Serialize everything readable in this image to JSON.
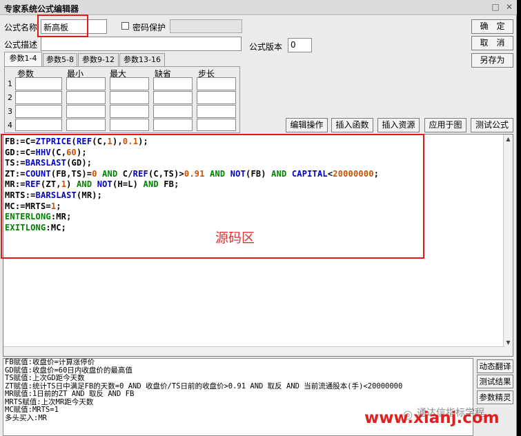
{
  "window": {
    "title": "专家系统公式编辑器",
    "min_icon": "□",
    "close_icon": "✕"
  },
  "form": {
    "name_label": "公式名称",
    "name_value": "新高板",
    "password_label": "密码保护",
    "desc_label": "公式描述",
    "desc_value": "",
    "version_label": "公式版本",
    "version_value": "0"
  },
  "buttons": {
    "ok": "确　定",
    "cancel": "取　消",
    "save_as": "另存为"
  },
  "tabs": [
    "参数1-4",
    "参数5-8",
    "参数9-12",
    "参数13-16"
  ],
  "param_headers": [
    "参数",
    "最小",
    "最大",
    "缺省",
    "步长"
  ],
  "param_rows": [
    "1",
    "2",
    "3",
    "4"
  ],
  "toolbar": [
    "编辑操作",
    "插入函数",
    "插入资源",
    "应用于图",
    "测试公式"
  ],
  "source_region_label": "源码区",
  "code_lines": [
    "FB:=C=ZTPRICE(REF(C,1),0.1);",
    "GD:=C=HHV(C,60);",
    "TS:=BARSLAST(GD);",
    "ZT:=COUNT(FB,TS)=0 AND C/REF(C,TS)>0.91 AND NOT(FB) AND CAPITAL<20000000;",
    "MR:=REF(ZT,1) AND NOT(H=L) AND FB;",
    "MRTS:=BARSLAST(MR);",
    "MC:=MRTS=1;",
    "ENTERLONG:MR;",
    "EXITLONG:MC;"
  ],
  "explain_lines": [
    "FB赋值:收盘价=计算涨停价",
    "GD赋值:收盘价=60日内收盘价的最高值",
    "TS赋值:上次GD距今天数",
    "ZT赋值:统计TS日中满足FB的天数=0 AND 收盘价/TS日前的收盘价>0.91 AND 取反 AND 当前流通股本(手)<20000000",
    "MR赋值:1日前的ZT AND 取反 AND FB",
    "MRTS赋值:上次MR距今天数",
    "MC赋值:MRTS=1",
    "多头买入:MR"
  ],
  "side_buttons": [
    "动态翻译",
    "测试结果",
    "参数精灵"
  ],
  "watermark": {
    "site": "www.xianj.com",
    "account": "通达信指标学程"
  },
  "colors": {
    "keyword_green": "#008000",
    "function_blue": "#0000c8",
    "number_orange": "#c85000",
    "highlight_red": "#e01818"
  }
}
